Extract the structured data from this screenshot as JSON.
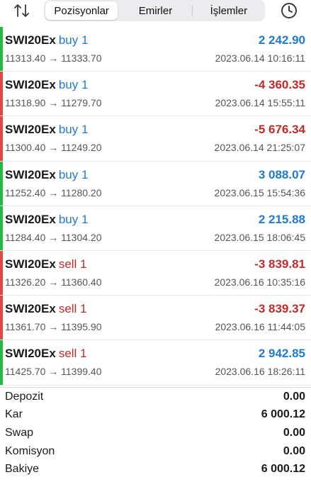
{
  "colors": {
    "profit_positive": "#1f7ad1",
    "profit_negative": "#c62828",
    "bar_buy": "#2eb34a",
    "bar_sell": "#d84a4a",
    "side_buy": "#1f7ad1",
    "side_sell": "#c62828"
  },
  "header": {
    "tabs": [
      {
        "label": "Pozisyonlar",
        "active": true
      },
      {
        "label": "Emirler",
        "active": false
      },
      {
        "label": "İşlemler",
        "active": false
      }
    ],
    "sort_icon": "sort-arrows-icon",
    "history_icon": "clock-icon"
  },
  "trades": [
    {
      "symbol": "SWI20Ex",
      "side": "buy 1",
      "direction": "buy",
      "prices": "11313.40 → 11333.70",
      "profit": "2 242.90",
      "profit_sign": "positive",
      "time": "2023.06.14 10:16:11",
      "bar": "buy"
    },
    {
      "symbol": "SWI20Ex",
      "side": "buy 1",
      "direction": "buy",
      "prices": "11318.90 → 11279.70",
      "profit": "-4 360.35",
      "profit_sign": "negative",
      "time": "2023.06.14 15:55:11",
      "bar": "sell"
    },
    {
      "symbol": "SWI20Ex",
      "side": "buy 1",
      "direction": "buy",
      "prices": "11300.40 → 11249.20",
      "profit": "-5 676.34",
      "profit_sign": "negative",
      "time": "2023.06.14 21:25:07",
      "bar": "sell"
    },
    {
      "symbol": "SWI20Ex",
      "side": "buy 1",
      "direction": "buy",
      "prices": "11252.40 → 11280.20",
      "profit": "3 088.07",
      "profit_sign": "positive",
      "time": "2023.06.15 15:54:36",
      "bar": "buy"
    },
    {
      "symbol": "SWI20Ex",
      "side": "buy 1",
      "direction": "buy",
      "prices": "11284.40 → 11304.20",
      "profit": "2 215.88",
      "profit_sign": "positive",
      "time": "2023.06.15 18:06:45",
      "bar": "buy"
    },
    {
      "symbol": "SWI20Ex",
      "side": "sell 1",
      "direction": "sell",
      "prices": "11326.20 → 11360.40",
      "profit": "-3 839.81",
      "profit_sign": "negative",
      "time": "2023.06.16 10:35:16",
      "bar": "sell"
    },
    {
      "symbol": "SWI20Ex",
      "side": "sell 1",
      "direction": "sell",
      "prices": "11361.70 → 11395.90",
      "profit": "-3 839.37",
      "profit_sign": "negative",
      "time": "2023.06.16 11:44:05",
      "bar": "sell"
    },
    {
      "symbol": "SWI20Ex",
      "side": "sell 1",
      "direction": "sell",
      "prices": "11425.70 → 11399.40",
      "profit": "2 942.85",
      "profit_sign": "positive",
      "time": "2023.06.16 18:26:11",
      "bar": "buy"
    }
  ],
  "summary": [
    {
      "label": "Depozit",
      "value": "0.00"
    },
    {
      "label": "Kar",
      "value": "6 000.12"
    },
    {
      "label": "Swap",
      "value": "0.00"
    },
    {
      "label": "Komisyon",
      "value": "0.00"
    },
    {
      "label": "Bakiye",
      "value": "6 000.12"
    }
  ]
}
